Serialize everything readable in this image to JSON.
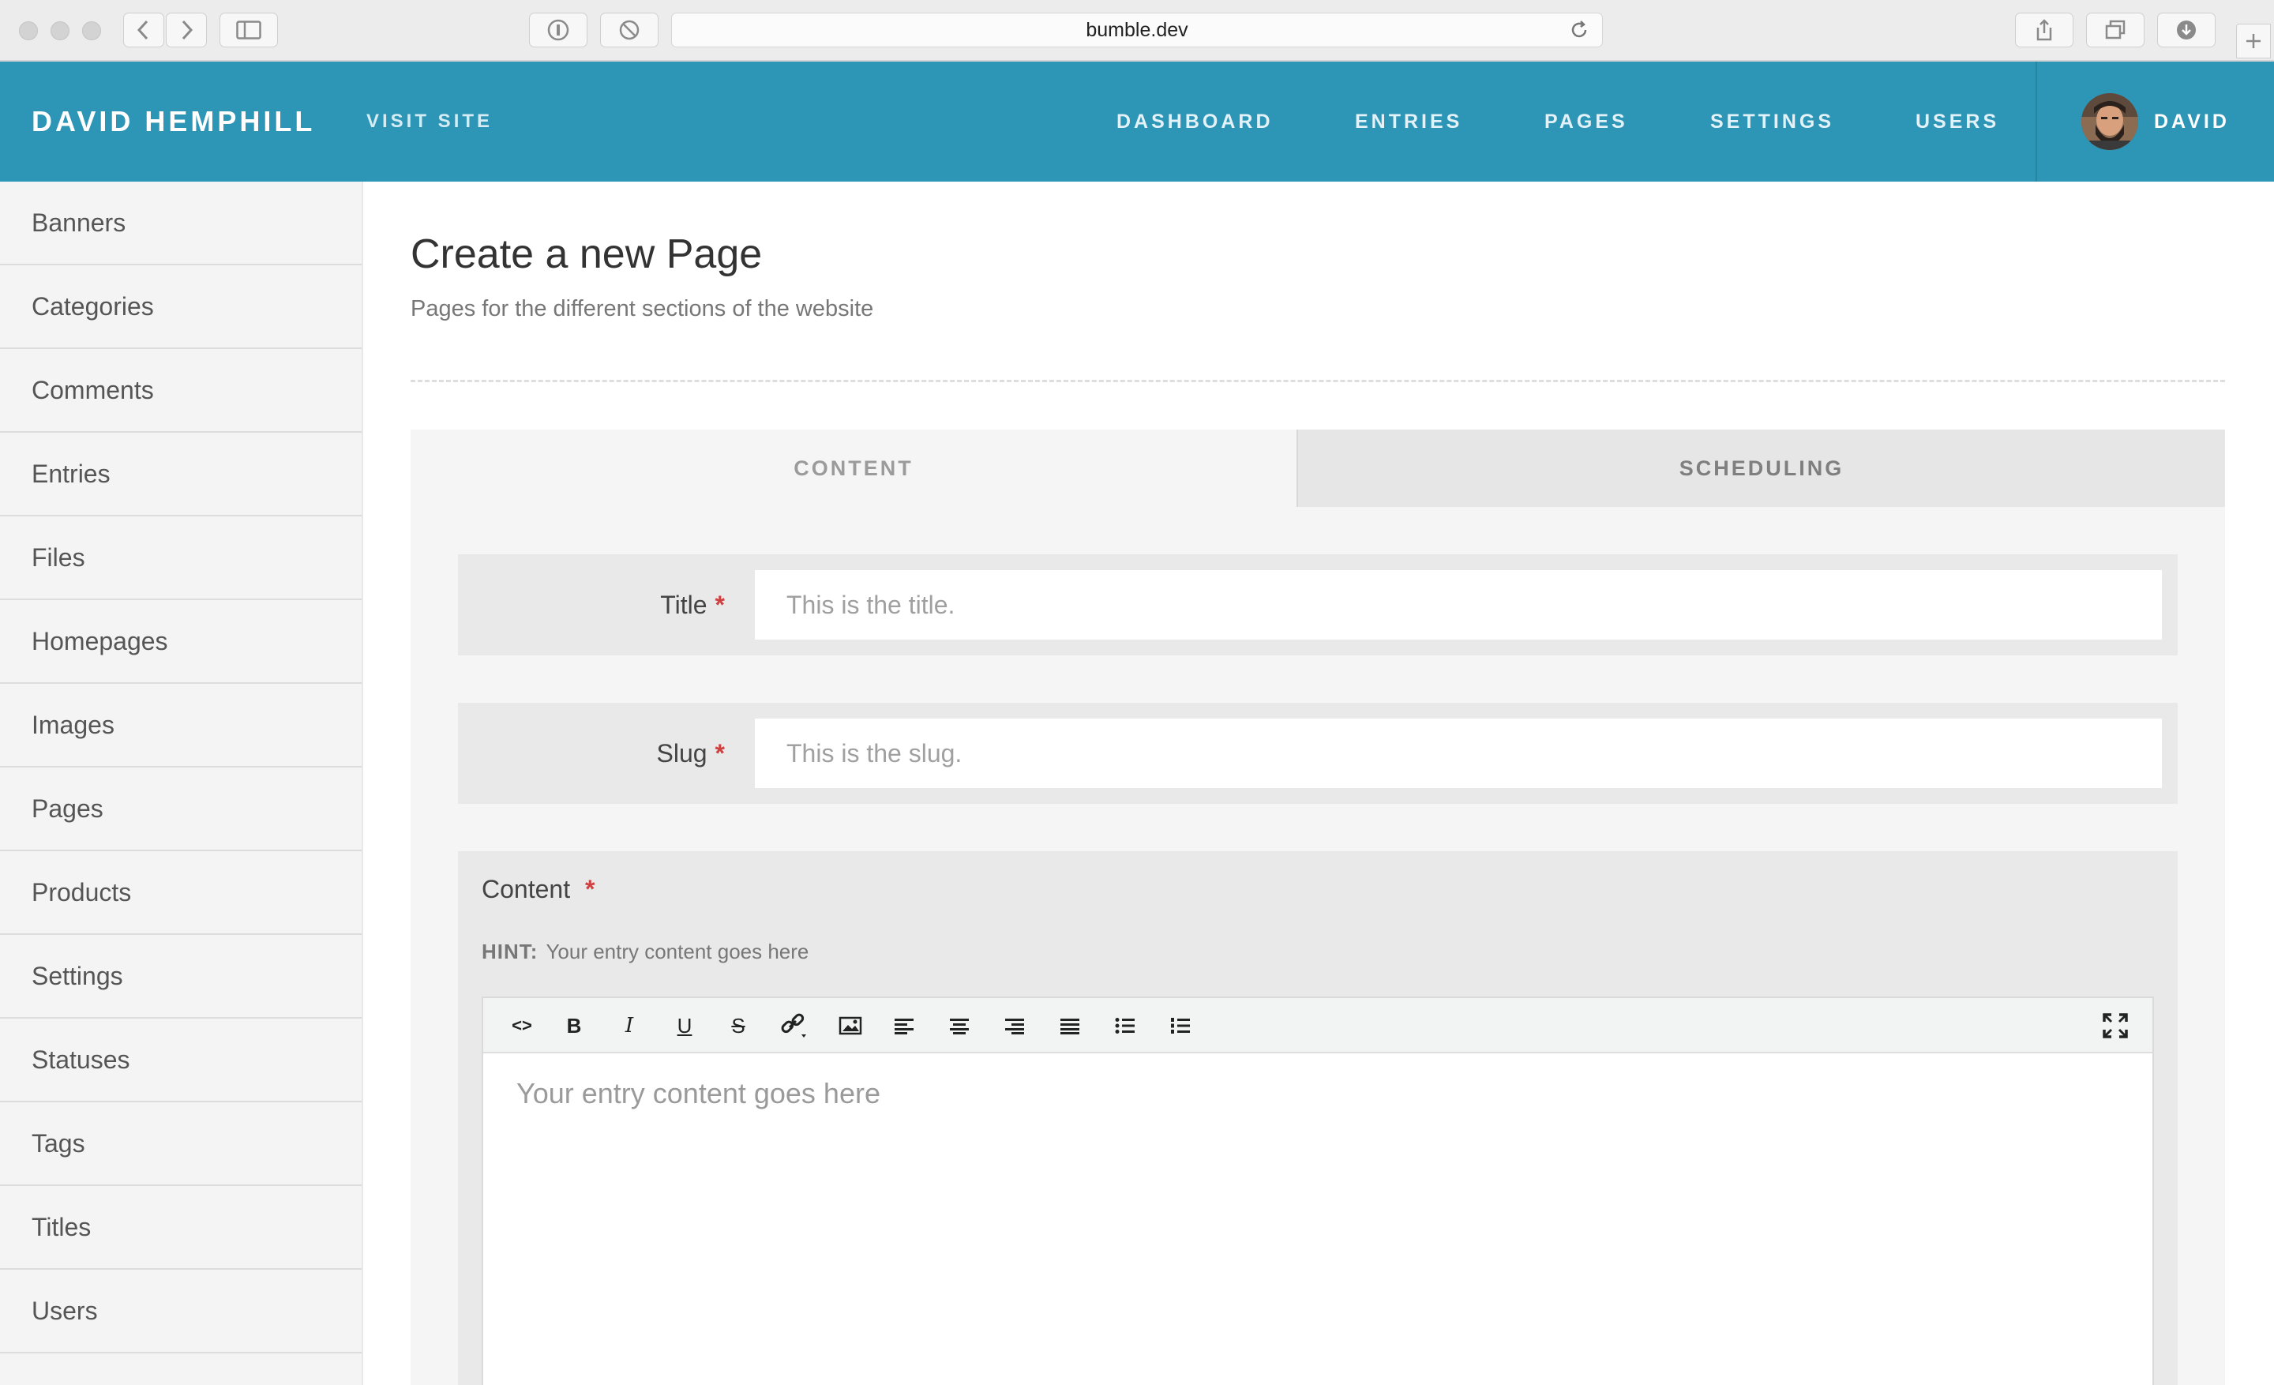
{
  "browser": {
    "url": "bumble.dev"
  },
  "topnav": {
    "brand": "DAVID HEMPHILL",
    "visit_site": "VISIT SITE",
    "items": [
      {
        "label": "DASHBOARD"
      },
      {
        "label": "ENTRIES"
      },
      {
        "label": "PAGES"
      },
      {
        "label": "SETTINGS"
      },
      {
        "label": "USERS"
      }
    ],
    "user": "DAVID"
  },
  "sidebar": {
    "items": [
      {
        "label": "Banners"
      },
      {
        "label": "Categories"
      },
      {
        "label": "Comments"
      },
      {
        "label": "Entries"
      },
      {
        "label": "Files"
      },
      {
        "label": "Homepages"
      },
      {
        "label": "Images"
      },
      {
        "label": "Pages"
      },
      {
        "label": "Products"
      },
      {
        "label": "Settings"
      },
      {
        "label": "Statuses"
      },
      {
        "label": "Tags"
      },
      {
        "label": "Titles"
      },
      {
        "label": "Users"
      }
    ]
  },
  "main": {
    "title": "Create a new Page",
    "subtitle": "Pages for the different sections of the website",
    "tabs": [
      {
        "label": "CONTENT",
        "active": true
      },
      {
        "label": "SCHEDULING",
        "active": false
      }
    ],
    "fields": {
      "title": {
        "label": "Title",
        "required": "*",
        "placeholder": "This is the title.",
        "value": ""
      },
      "slug": {
        "label": "Slug",
        "required": "*",
        "placeholder": "This is the slug.",
        "value": ""
      }
    },
    "content": {
      "label": "Content",
      "required": "*",
      "hint_label": "HINT:",
      "hint_text": "Your entry content goes here",
      "editor_placeholder": "Your entry content goes here",
      "toolbar": {
        "code": "<>",
        "bold": "B",
        "italic": "I",
        "underline": "U",
        "strike": "S"
      }
    }
  },
  "colors": {
    "nav": "#2d95b6",
    "required": "#d04040"
  }
}
